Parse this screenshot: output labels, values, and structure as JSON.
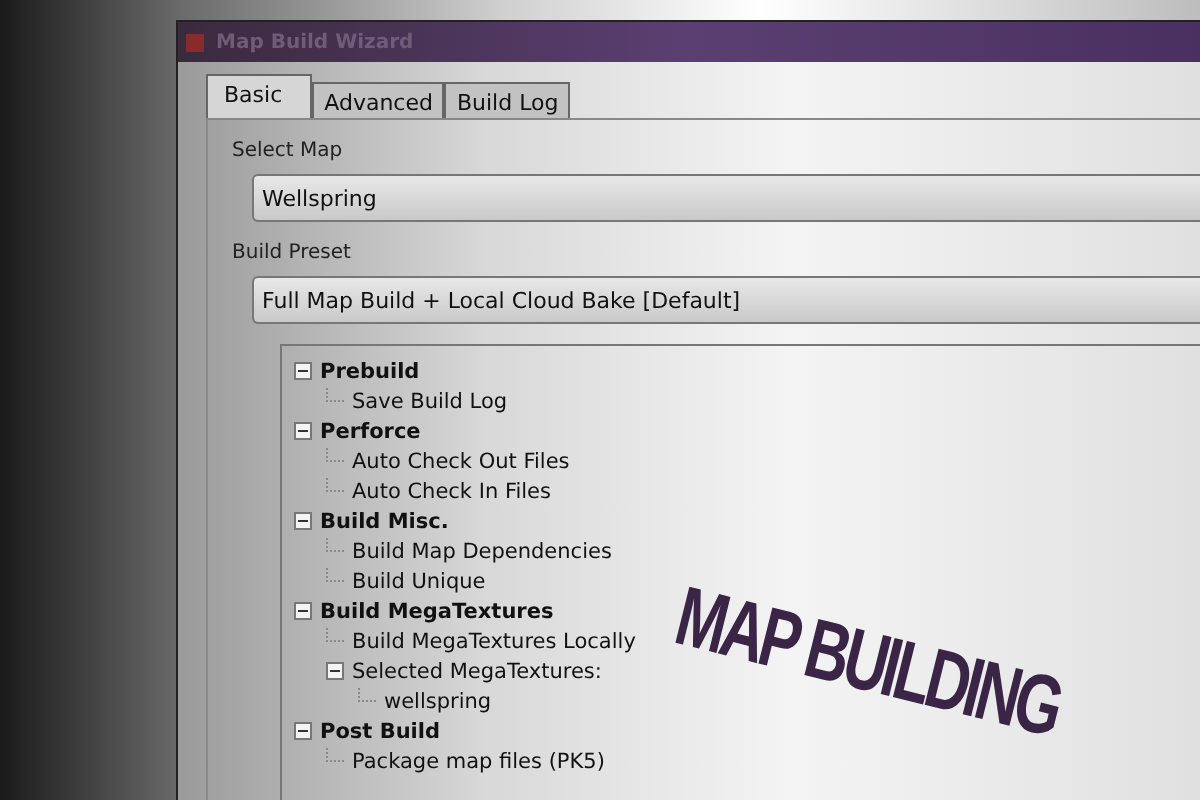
{
  "window": {
    "title": "Map Build Wizard"
  },
  "tabs": [
    {
      "label": "Basic",
      "selected": true
    },
    {
      "label": "Advanced",
      "selected": false
    },
    {
      "label": "Build Log",
      "selected": false
    }
  ],
  "select_map": {
    "label": "Select Map",
    "value": "Wellspring"
  },
  "build_preset": {
    "label": "Build Preset",
    "value": "Full Map Build + Local Cloud Bake [Default]"
  },
  "tree": [
    {
      "label": "Prebuild",
      "expanded": true,
      "children": [
        {
          "label": "Save Build Log"
        }
      ]
    },
    {
      "label": "Perforce",
      "expanded": true,
      "children": [
        {
          "label": "Auto Check Out Files"
        },
        {
          "label": "Auto Check In Files"
        }
      ]
    },
    {
      "label": "Build Misc.",
      "expanded": true,
      "children": [
        {
          "label": "Build Map Dependencies"
        },
        {
          "label": "Build Unique"
        }
      ]
    },
    {
      "label": "Build MegaTextures",
      "expanded": true,
      "children": [
        {
          "label": "Build MegaTextures Locally"
        },
        {
          "label": "Selected MegaTextures:",
          "expanded": true,
          "children": [
            {
              "label": "wellspring"
            }
          ]
        }
      ]
    },
    {
      "label": "Post Build",
      "expanded": true,
      "children": [
        {
          "label": "Package map files (PK5)"
        }
      ]
    }
  ],
  "overlay_title": "MAP BUILDING"
}
